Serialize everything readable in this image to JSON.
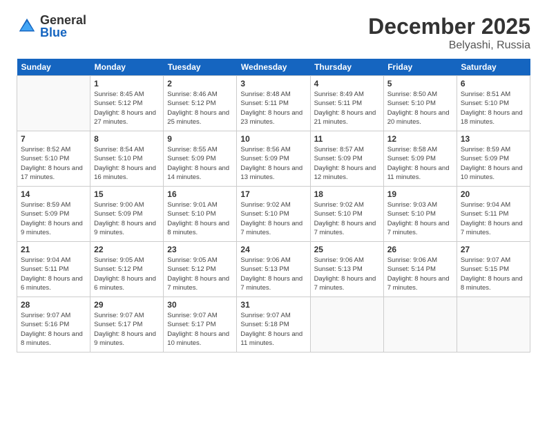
{
  "header": {
    "logo_general": "General",
    "logo_blue": "Blue",
    "month_year": "December 2025",
    "location": "Belyashi, Russia"
  },
  "weekdays": [
    "Sunday",
    "Monday",
    "Tuesday",
    "Wednesday",
    "Thursday",
    "Friday",
    "Saturday"
  ],
  "weeks": [
    [
      {
        "day": "",
        "info": ""
      },
      {
        "day": "1",
        "sunrise": "Sunrise: 8:45 AM",
        "sunset": "Sunset: 5:12 PM",
        "daylight": "Daylight: 8 hours and 27 minutes."
      },
      {
        "day": "2",
        "sunrise": "Sunrise: 8:46 AM",
        "sunset": "Sunset: 5:12 PM",
        "daylight": "Daylight: 8 hours and 25 minutes."
      },
      {
        "day": "3",
        "sunrise": "Sunrise: 8:48 AM",
        "sunset": "Sunset: 5:11 PM",
        "daylight": "Daylight: 8 hours and 23 minutes."
      },
      {
        "day": "4",
        "sunrise": "Sunrise: 8:49 AM",
        "sunset": "Sunset: 5:11 PM",
        "daylight": "Daylight: 8 hours and 21 minutes."
      },
      {
        "day": "5",
        "sunrise": "Sunrise: 8:50 AM",
        "sunset": "Sunset: 5:10 PM",
        "daylight": "Daylight: 8 hours and 20 minutes."
      },
      {
        "day": "6",
        "sunrise": "Sunrise: 8:51 AM",
        "sunset": "Sunset: 5:10 PM",
        "daylight": "Daylight: 8 hours and 18 minutes."
      }
    ],
    [
      {
        "day": "7",
        "sunrise": "Sunrise: 8:52 AM",
        "sunset": "Sunset: 5:10 PM",
        "daylight": "Daylight: 8 hours and 17 minutes."
      },
      {
        "day": "8",
        "sunrise": "Sunrise: 8:54 AM",
        "sunset": "Sunset: 5:10 PM",
        "daylight": "Daylight: 8 hours and 16 minutes."
      },
      {
        "day": "9",
        "sunrise": "Sunrise: 8:55 AM",
        "sunset": "Sunset: 5:09 PM",
        "daylight": "Daylight: 8 hours and 14 minutes."
      },
      {
        "day": "10",
        "sunrise": "Sunrise: 8:56 AM",
        "sunset": "Sunset: 5:09 PM",
        "daylight": "Daylight: 8 hours and 13 minutes."
      },
      {
        "day": "11",
        "sunrise": "Sunrise: 8:57 AM",
        "sunset": "Sunset: 5:09 PM",
        "daylight": "Daylight: 8 hours and 12 minutes."
      },
      {
        "day": "12",
        "sunrise": "Sunrise: 8:58 AM",
        "sunset": "Sunset: 5:09 PM",
        "daylight": "Daylight: 8 hours and 11 minutes."
      },
      {
        "day": "13",
        "sunrise": "Sunrise: 8:59 AM",
        "sunset": "Sunset: 5:09 PM",
        "daylight": "Daylight: 8 hours and 10 minutes."
      }
    ],
    [
      {
        "day": "14",
        "sunrise": "Sunrise: 8:59 AM",
        "sunset": "Sunset: 5:09 PM",
        "daylight": "Daylight: 8 hours and 9 minutes."
      },
      {
        "day": "15",
        "sunrise": "Sunrise: 9:00 AM",
        "sunset": "Sunset: 5:09 PM",
        "daylight": "Daylight: 8 hours and 9 minutes."
      },
      {
        "day": "16",
        "sunrise": "Sunrise: 9:01 AM",
        "sunset": "Sunset: 5:10 PM",
        "daylight": "Daylight: 8 hours and 8 minutes."
      },
      {
        "day": "17",
        "sunrise": "Sunrise: 9:02 AM",
        "sunset": "Sunset: 5:10 PM",
        "daylight": "Daylight: 8 hours and 7 minutes."
      },
      {
        "day": "18",
        "sunrise": "Sunrise: 9:02 AM",
        "sunset": "Sunset: 5:10 PM",
        "daylight": "Daylight: 8 hours and 7 minutes."
      },
      {
        "day": "19",
        "sunrise": "Sunrise: 9:03 AM",
        "sunset": "Sunset: 5:10 PM",
        "daylight": "Daylight: 8 hours and 7 minutes."
      },
      {
        "day": "20",
        "sunrise": "Sunrise: 9:04 AM",
        "sunset": "Sunset: 5:11 PM",
        "daylight": "Daylight: 8 hours and 7 minutes."
      }
    ],
    [
      {
        "day": "21",
        "sunrise": "Sunrise: 9:04 AM",
        "sunset": "Sunset: 5:11 PM",
        "daylight": "Daylight: 8 hours and 6 minutes."
      },
      {
        "day": "22",
        "sunrise": "Sunrise: 9:05 AM",
        "sunset": "Sunset: 5:12 PM",
        "daylight": "Daylight: 8 hours and 6 minutes."
      },
      {
        "day": "23",
        "sunrise": "Sunrise: 9:05 AM",
        "sunset": "Sunset: 5:12 PM",
        "daylight": "Daylight: 8 hours and 7 minutes."
      },
      {
        "day": "24",
        "sunrise": "Sunrise: 9:06 AM",
        "sunset": "Sunset: 5:13 PM",
        "daylight": "Daylight: 8 hours and 7 minutes."
      },
      {
        "day": "25",
        "sunrise": "Sunrise: 9:06 AM",
        "sunset": "Sunset: 5:13 PM",
        "daylight": "Daylight: 8 hours and 7 minutes."
      },
      {
        "day": "26",
        "sunrise": "Sunrise: 9:06 AM",
        "sunset": "Sunset: 5:14 PM",
        "daylight": "Daylight: 8 hours and 7 minutes."
      },
      {
        "day": "27",
        "sunrise": "Sunrise: 9:07 AM",
        "sunset": "Sunset: 5:15 PM",
        "daylight": "Daylight: 8 hours and 8 minutes."
      }
    ],
    [
      {
        "day": "28",
        "sunrise": "Sunrise: 9:07 AM",
        "sunset": "Sunset: 5:16 PM",
        "daylight": "Daylight: 8 hours and 8 minutes."
      },
      {
        "day": "29",
        "sunrise": "Sunrise: 9:07 AM",
        "sunset": "Sunset: 5:17 PM",
        "daylight": "Daylight: 8 hours and 9 minutes."
      },
      {
        "day": "30",
        "sunrise": "Sunrise: 9:07 AM",
        "sunset": "Sunset: 5:17 PM",
        "daylight": "Daylight: 8 hours and 10 minutes."
      },
      {
        "day": "31",
        "sunrise": "Sunrise: 9:07 AM",
        "sunset": "Sunset: 5:18 PM",
        "daylight": "Daylight: 8 hours and 11 minutes."
      },
      {
        "day": "",
        "info": ""
      },
      {
        "day": "",
        "info": ""
      },
      {
        "day": "",
        "info": ""
      }
    ]
  ]
}
